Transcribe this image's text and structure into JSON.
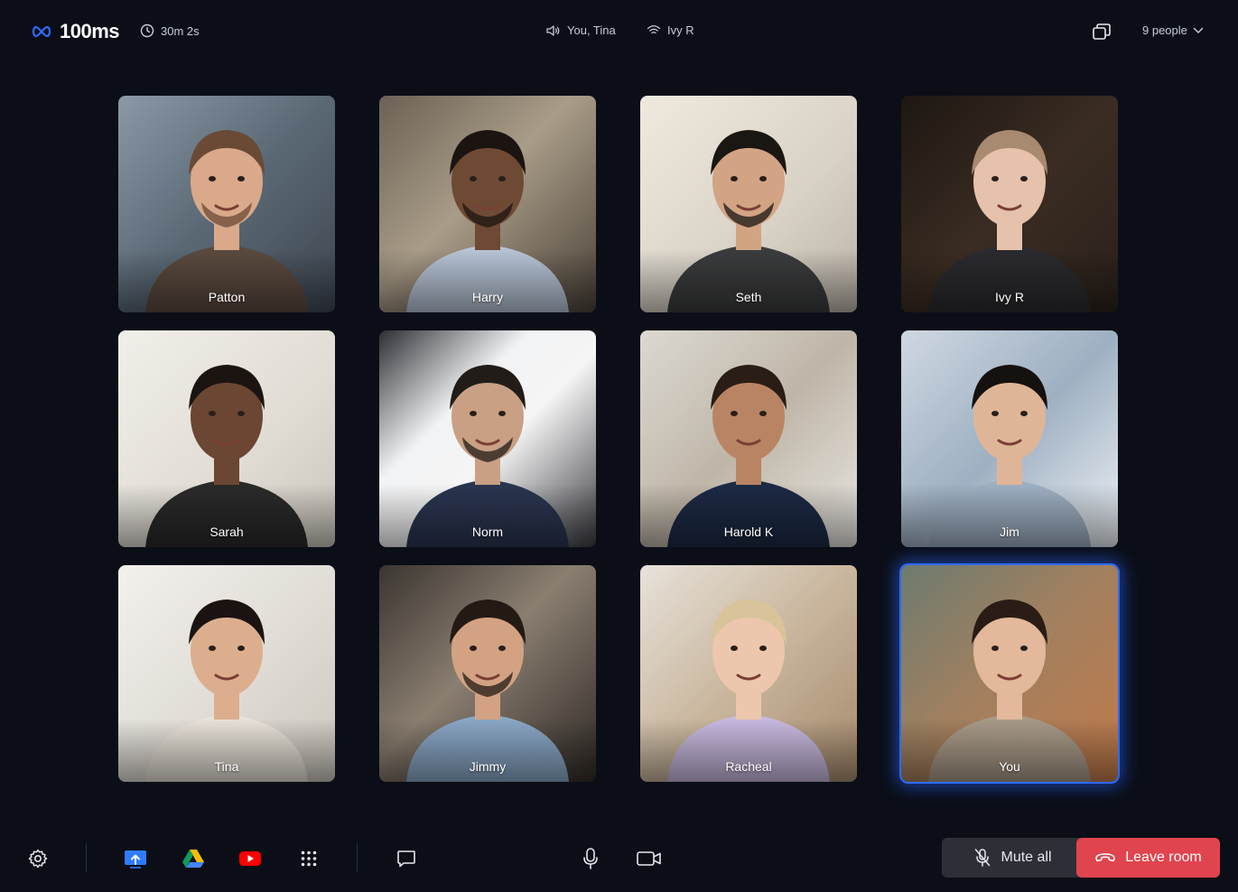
{
  "app": {
    "logo_text": "100ms"
  },
  "header": {
    "timer": "30m 2s",
    "speaking": "You, Tina",
    "network": "Ivy R",
    "people_label": "9 people"
  },
  "participants": [
    {
      "name": "Patton"
    },
    {
      "name": "Harry"
    },
    {
      "name": "Seth"
    },
    {
      "name": "Ivy R"
    },
    {
      "name": "Sarah"
    },
    {
      "name": "Norm"
    },
    {
      "name": "Harold K"
    },
    {
      "name": "Jim"
    },
    {
      "name": "Tina"
    },
    {
      "name": "Jimmy"
    },
    {
      "name": "Racheal"
    },
    {
      "name": "You",
      "active": true
    }
  ],
  "footer": {
    "mute_all_label": "Mute all",
    "leave_label": "Leave room"
  },
  "colors": {
    "background": "#0b0e17",
    "accent": "#2f6bff",
    "leave": "#e0444e",
    "mute_all_bg": "#2c2f36"
  }
}
